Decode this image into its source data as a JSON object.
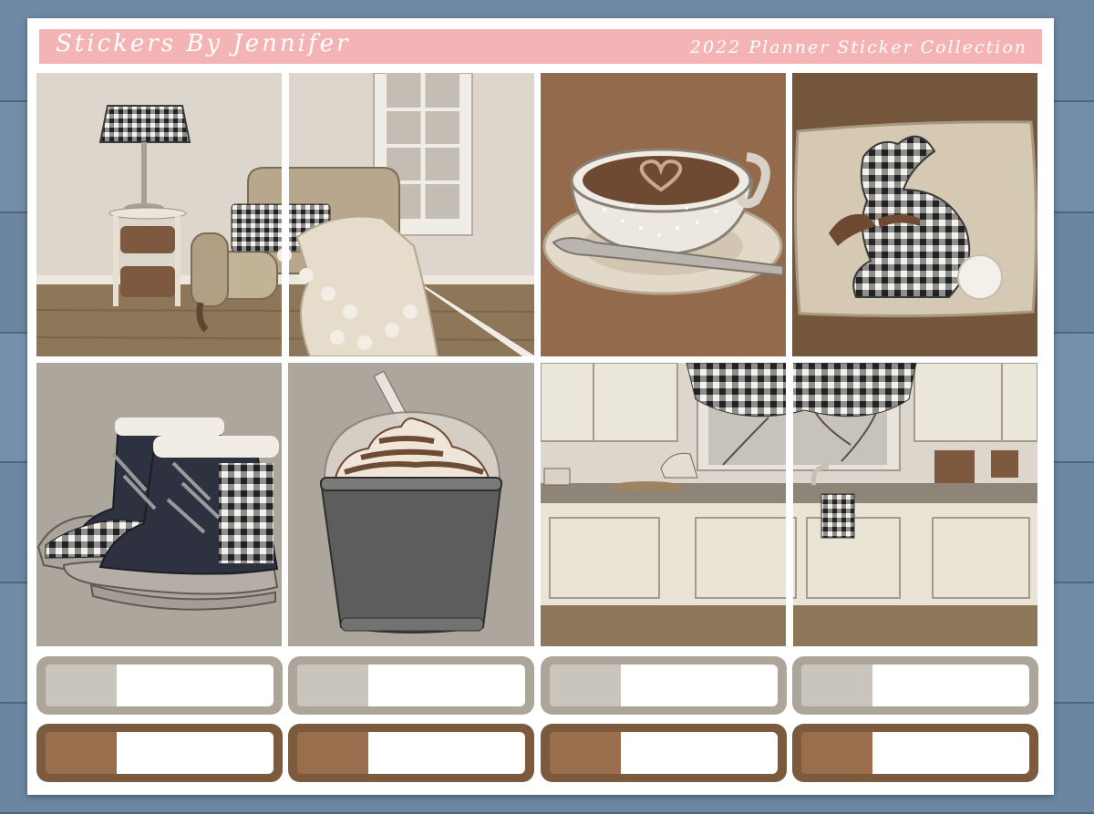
{
  "sheet": {
    "brand": "Stickers By Jennifer",
    "collection": "2022 Planner Sticker Collection"
  },
  "colors": {
    "background_wood": "#6f8aa6",
    "banner_pink": "#f4b4b5",
    "gray_label": "#aea59a",
    "gray_swatch": "#c9c4bc",
    "brown_label": "#7b5a3e",
    "brown_swatch": "#9a6e4c",
    "wall_beige": "#ddd6cc",
    "coffee_brown": "#936a4b",
    "pillow_bg": "#74563c",
    "floor": "#8e7659"
  },
  "stickers": [
    {
      "name": "living-room-chair",
      "icon": "armchair-lamp-scene"
    },
    {
      "name": "latte-cup",
      "icon": "coffee-cup-icon"
    },
    {
      "name": "bunny-pillow",
      "icon": "gingham-bunny-pillow"
    },
    {
      "name": "winter-boots",
      "icon": "boots-icon"
    },
    {
      "name": "frappe-drink",
      "icon": "whipped-drink-icon"
    },
    {
      "name": "kitchen-scene",
      "icon": "kitchen-counter-scene"
    }
  ],
  "labels": {
    "gray_row_count": 4,
    "brown_row_count": 4
  }
}
